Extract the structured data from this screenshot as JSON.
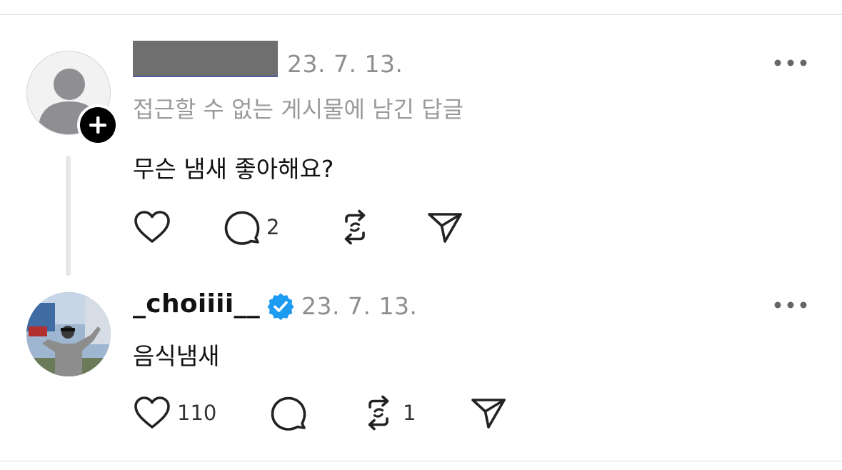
{
  "post": {
    "date": "23. 7. 13.",
    "context_label": "접근할 수 없는 게시물에 남긴 답글",
    "text": "무슨 냄새 좋아해요?",
    "comment_count": "2",
    "avatar_icon": "default-user-avatar-icon",
    "follow_icon": "plus-icon"
  },
  "reply": {
    "username": "_choiiii__",
    "verified_icon": "verified-badge-icon",
    "date": "23. 7. 13.",
    "text": "음식냄새",
    "like_count": "110",
    "repost_count": "1"
  },
  "colors": {
    "verified_blue": "#1d9bf0",
    "muted_text": "#8e8e8e",
    "divider": "#dcdcdc"
  }
}
